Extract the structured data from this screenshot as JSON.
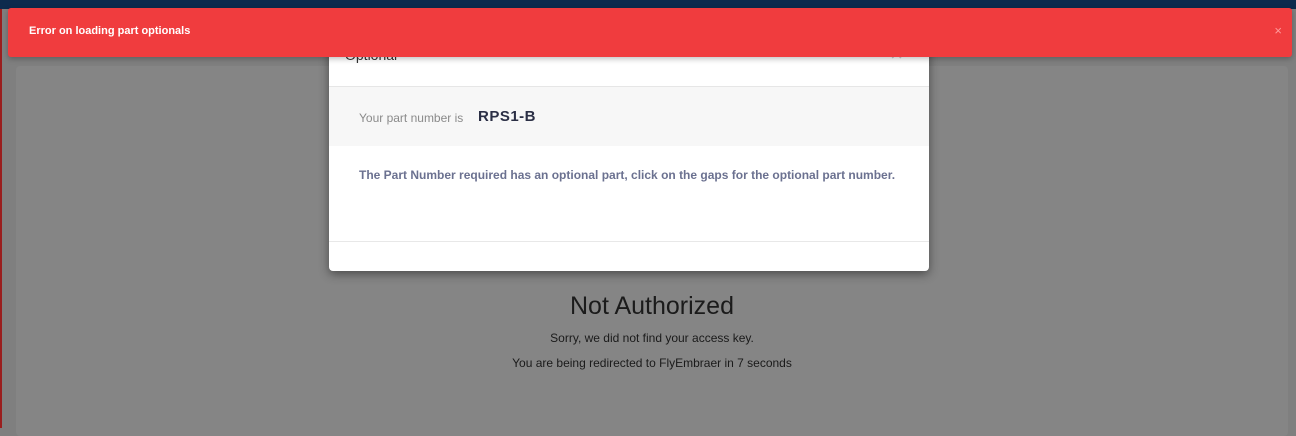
{
  "toast": {
    "message": "Error on loading part optionals",
    "close_glyph": "×",
    "color": "#f03c3e"
  },
  "modal": {
    "title": "Optional",
    "close_glyph": "×",
    "part_label": "Your part number is",
    "part_number": "RPS1-B",
    "description": "The Part Number required has an optional part, click on the gaps for the optional part number."
  },
  "page": {
    "title": "Not Authorized",
    "message": "Sorry, we did not find your access key.",
    "redirect": "You are being redirected to FlyEmbraer in 7 seconds"
  }
}
